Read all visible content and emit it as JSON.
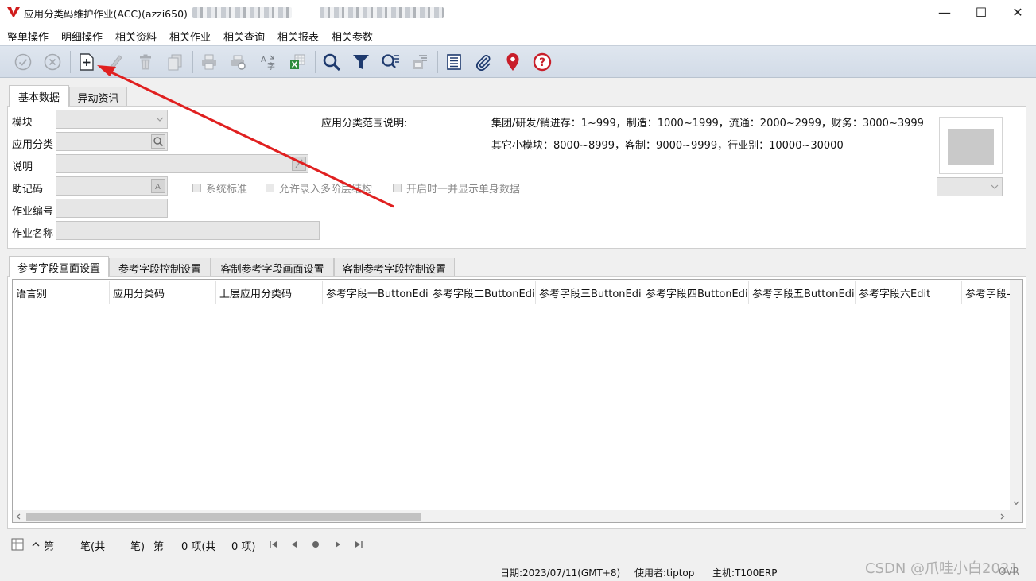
{
  "window": {
    "title": "应用分类码维护作业(ACC)(azzi650)",
    "controls": {
      "minimize": "—",
      "maximize": "☐",
      "close": "✕"
    }
  },
  "menu": [
    "整单操作",
    "明细操作",
    "相关资料",
    "相关作业",
    "相关查询",
    "相关报表",
    "相关参数"
  ],
  "toolbar": {
    "icons": [
      "confirm-icon",
      "cancel-icon",
      "add-icon",
      "edit-icon",
      "delete-icon",
      "copy-icon",
      "print-icon",
      "print-preview-icon",
      "translate-icon",
      "export-excel-icon",
      "search-icon",
      "filter-icon",
      "query-list-icon",
      "export-icon",
      "report-icon",
      "attachment-icon",
      "location-pin-icon",
      "help-icon"
    ]
  },
  "main_tabs": [
    "基本数据",
    "异动资讯"
  ],
  "form": {
    "module_label": "模块",
    "app_category_label": "应用分类",
    "description_label": "说明",
    "mnemonic_label": "助记码",
    "job_no_label": "作业编号",
    "job_name_label": "作业名称",
    "range_label": "应用分类范围说明:",
    "range_line1": "集团/研发/销进存：1~999，制造：1000~1999，流通：2000~2999，财务：3000~3999",
    "range_line2": "其它小模块：8000~8999，客制：9000~9999，行业别：10000~30000",
    "chk_system_standard": "系统标准",
    "chk_multi_level": "允许录入多阶层结构",
    "chk_show_single": "开启时一并显示单身数据"
  },
  "detail_tabs": [
    "参考字段画面设置",
    "参考字段控制设置",
    "客制参考字段画面设置",
    "客制参考字段控制设置"
  ],
  "grid": {
    "columns": [
      "语言别",
      "应用分类码",
      "上层应用分类码",
      "参考字段一ButtonEdi",
      "参考字段二ButtonEdi",
      "参考字段三ButtonEdi",
      "参考字段四ButtonEdi",
      "参考字段五ButtonEdi",
      "参考字段六Edit",
      "参考字段-"
    ]
  },
  "pager": {
    "t1": "第",
    "t2": "笔(共",
    "t3": "笔)",
    "t4": "第",
    "t5": "0 项(共",
    "t6": "0 项)"
  },
  "status": {
    "date": "日期:2023/07/11(GMT+8)",
    "user": "使用者:tiptop",
    "host": "主机:T100ERP",
    "ovr": "OVR"
  },
  "watermark": "CSDN @爪哇小白2021",
  "colors": {
    "annotation_arrow": "#e02020",
    "toolbar_bg": "#d8e0ea"
  }
}
